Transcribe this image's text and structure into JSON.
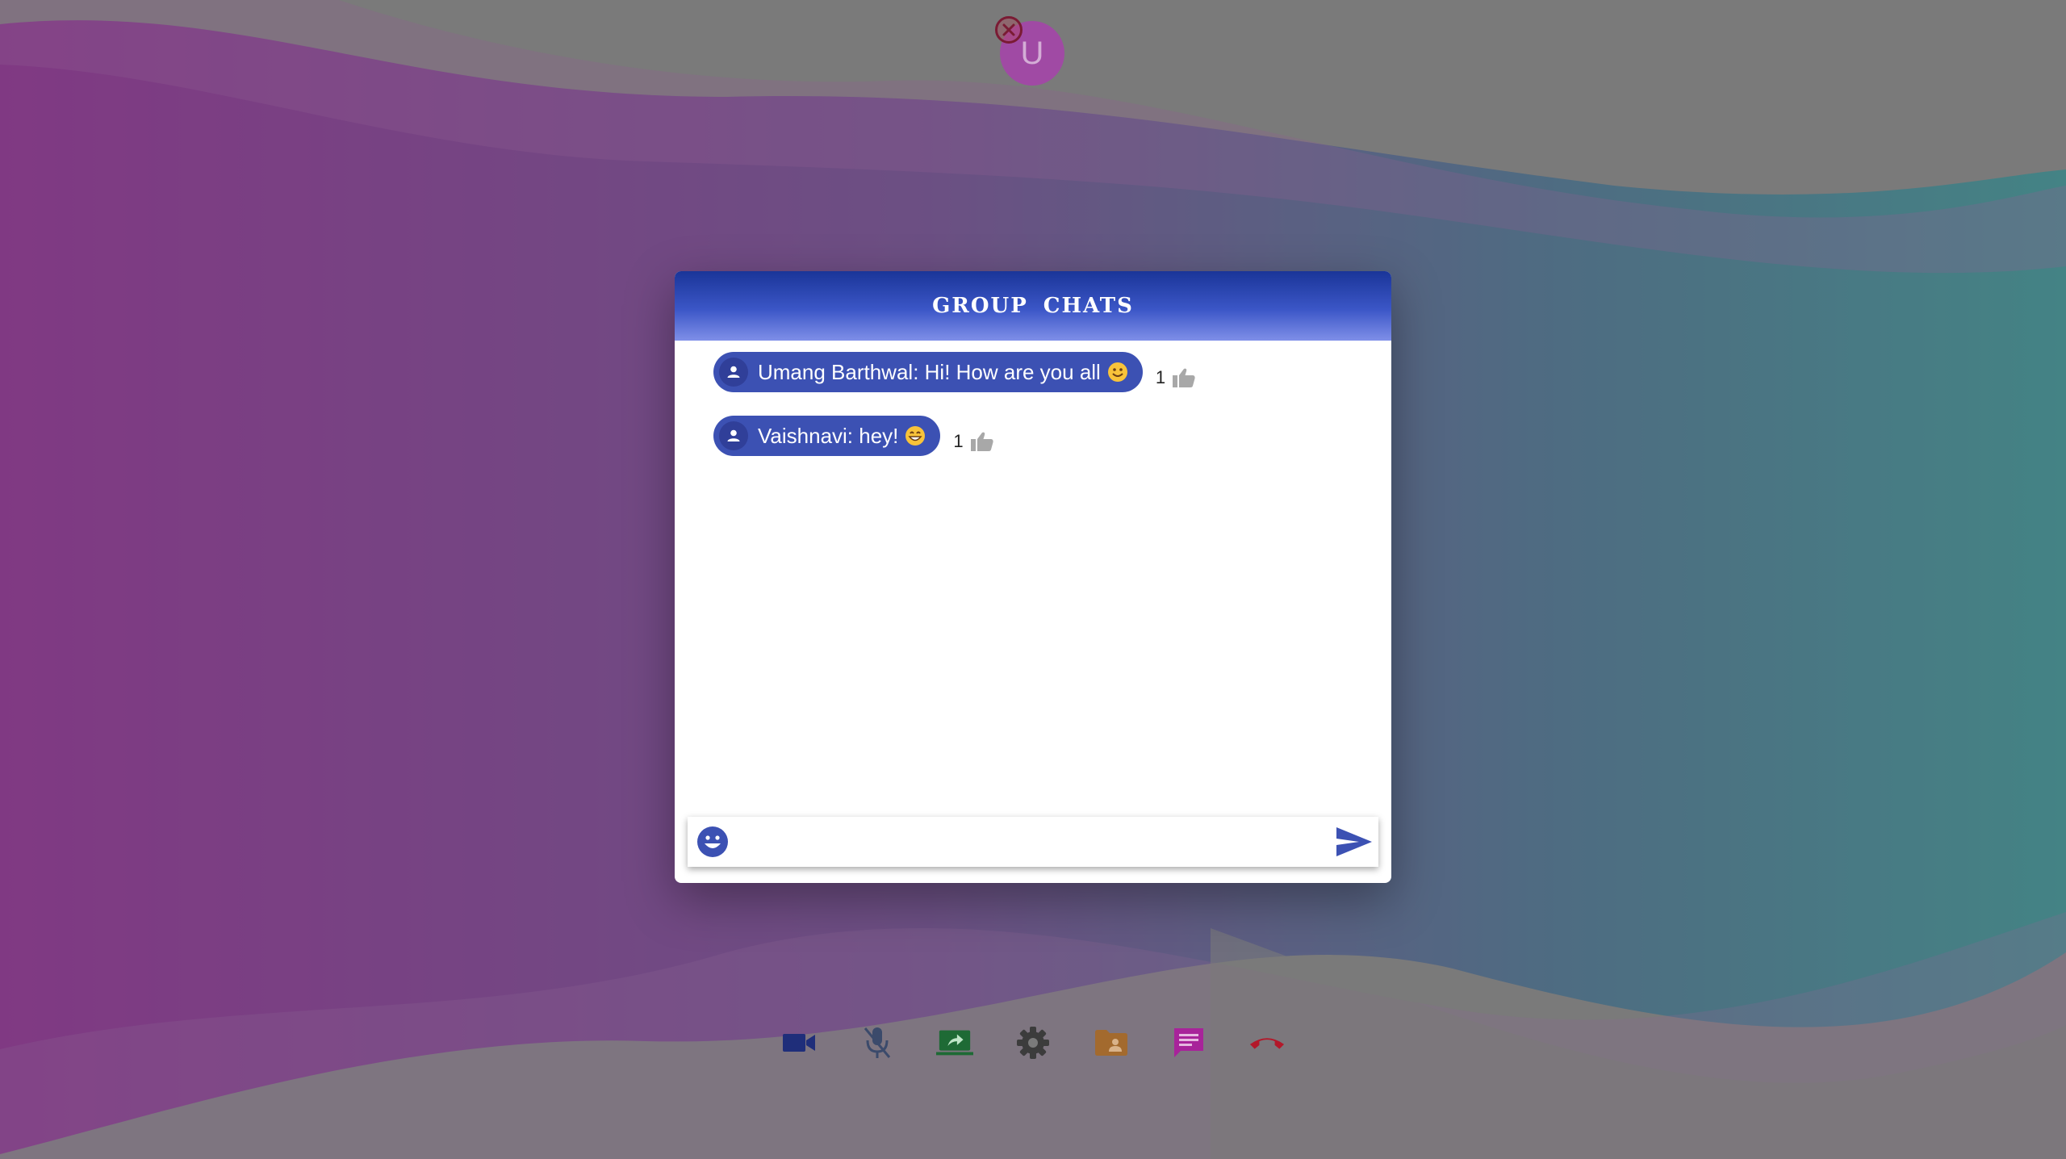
{
  "participant": {
    "initial": "U",
    "close_icon": "close-circle-icon",
    "color": "#a04aa4"
  },
  "chat": {
    "title": "GROUP  CHATS",
    "header_gradient": [
      "#1a3598",
      "#7f8fe8"
    ],
    "bubble_color": "#3c51b3",
    "messages": [
      {
        "text": "Umang Barthwal: Hi! How are you all",
        "emoji": "smiling-face",
        "likes": "1"
      },
      {
        "text": "Vaishnavi: hey!",
        "emoji": "grinning-face",
        "likes": "1"
      }
    ],
    "composer": {
      "placeholder": "",
      "value": ""
    }
  },
  "toolbar": {
    "items": [
      {
        "name": "video-camera",
        "color": "#1f2e7a"
      },
      {
        "name": "mic-off",
        "color": "#3b4a6b"
      },
      {
        "name": "screen-share",
        "color": "#1e6a35"
      },
      {
        "name": "settings",
        "color": "#3c3c3c"
      },
      {
        "name": "participants-folder",
        "color": "#a36a2e"
      },
      {
        "name": "chat",
        "color": "#a8239a"
      },
      {
        "name": "end-call",
        "color": "#b3182a"
      }
    ]
  }
}
